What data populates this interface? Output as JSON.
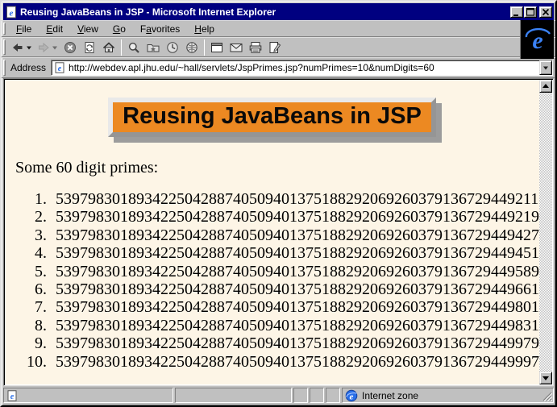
{
  "window": {
    "title": "Reusing JavaBeans in JSP - Microsoft Internet Explorer",
    "controls": {
      "minimize": "minimize",
      "maximize": "maximize",
      "close": "close"
    }
  },
  "colors": {
    "titlebar": "#000080",
    "chrome": "#C0C0C0",
    "pagebg": "#FDF5E6",
    "orange": "#EC8922",
    "shadow": "#9C9C9C",
    "ieblue": "#3B82F6"
  },
  "menu_bar": {
    "items": [
      {
        "label": "File",
        "accel": 0
      },
      {
        "label": "Edit",
        "accel": 0
      },
      {
        "label": "View",
        "accel": 0
      },
      {
        "label": "Go",
        "accel": 0
      },
      {
        "label": "Favorites",
        "accel": 1
      },
      {
        "label": "Help",
        "accel": 0
      }
    ]
  },
  "toolbar": {
    "buttons": [
      {
        "name": "back",
        "icon": "back-icon",
        "caret": true
      },
      {
        "name": "forward",
        "icon": "forward-icon",
        "caret": true,
        "disabled": true
      },
      {
        "name": "stop",
        "icon": "stop-icon"
      },
      {
        "name": "refresh",
        "icon": "refresh-icon"
      },
      {
        "name": "home",
        "icon": "home-icon"
      },
      {
        "sep": true
      },
      {
        "name": "search",
        "icon": "search-icon"
      },
      {
        "name": "favorites",
        "icon": "favorites-icon"
      },
      {
        "name": "history",
        "icon": "history-icon"
      },
      {
        "name": "channels",
        "icon": "channels-icon"
      },
      {
        "sep": true
      },
      {
        "name": "fullscreen",
        "icon": "fullscreen-icon"
      },
      {
        "name": "mail",
        "icon": "mail-icon"
      },
      {
        "name": "print",
        "icon": "print-icon"
      },
      {
        "name": "edit",
        "icon": "edit-icon"
      }
    ]
  },
  "address_bar": {
    "label": "Address",
    "url": "http://webdev.apl.jhu.edu/~hall/servlets/JspPrimes.jsp?numPrimes=10&numDigits=60"
  },
  "page": {
    "heading": "Reusing JavaBeans in JSP",
    "intro": "Some 60 digit primes:",
    "primes": [
      "539798301893422504288740509401375188292069260379136729449211",
      "539798301893422504288740509401375188292069260379136729449219",
      "539798301893422504288740509401375188292069260379136729449427",
      "539798301893422504288740509401375188292069260379136729449451",
      "539798301893422504288740509401375188292069260379136729449589",
      "539798301893422504288740509401375188292069260379136729449661",
      "539798301893422504288740509401375188292069260379136729449801",
      "539798301893422504288740509401375188292069260379136729449831",
      "539798301893422504288740509401375188292069260379136729449979",
      "539798301893422504288740509401375188292069260379136729449997"
    ]
  },
  "status_bar": {
    "zone": "Internet zone"
  }
}
